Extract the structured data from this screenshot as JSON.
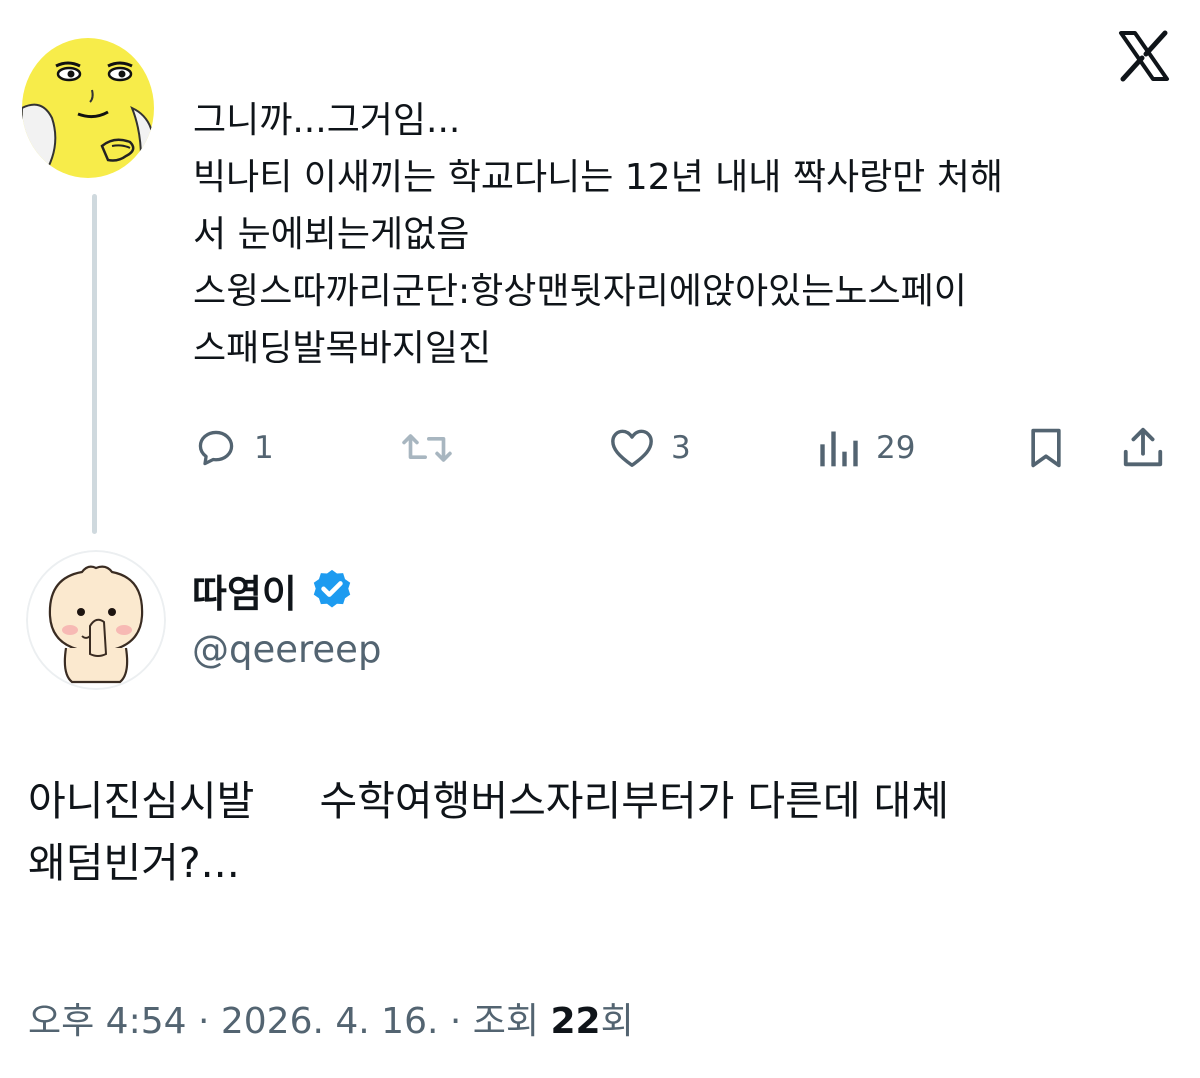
{
  "parent_tweet": {
    "lines": [
      "그니까...그거임...",
      "빅나티 이새끼는 학교다니는 12년 내내 짝사랑만 처해",
      "서 눈에뵈는게없음",
      "스윙스따까리군단:항상맨뒷자리에앉아있는노스페이",
      "스패딩발목바지일진"
    ],
    "actions": {
      "reply_count": "1",
      "repost_count": "",
      "like_count": "3",
      "view_count": "29"
    },
    "avatar_icon": "yellow-smirk-face-avatar"
  },
  "reply_tweet": {
    "author_name": "따염이",
    "verified_icon": "verified-badge-icon",
    "handle": "@qeereep",
    "lines": [
      "아니진심시발     수학여행버스자리부터가 다른데 대체",
      "왜덤빈거?..."
    ],
    "time": "오후 4:54",
    "date": "2026. 4. 16.",
    "views_label": "조회",
    "views_count": "22",
    "views_suffix": "회",
    "avatar_icon": "dumpling-character-avatar"
  },
  "brand_icon": "x-logo-icon",
  "colors": {
    "text": "#0f1419",
    "secondary": "#536471",
    "thread_line": "#cfd9de",
    "verified": "#1d9bf0",
    "avatar_yellow": "#f7ec4a"
  }
}
